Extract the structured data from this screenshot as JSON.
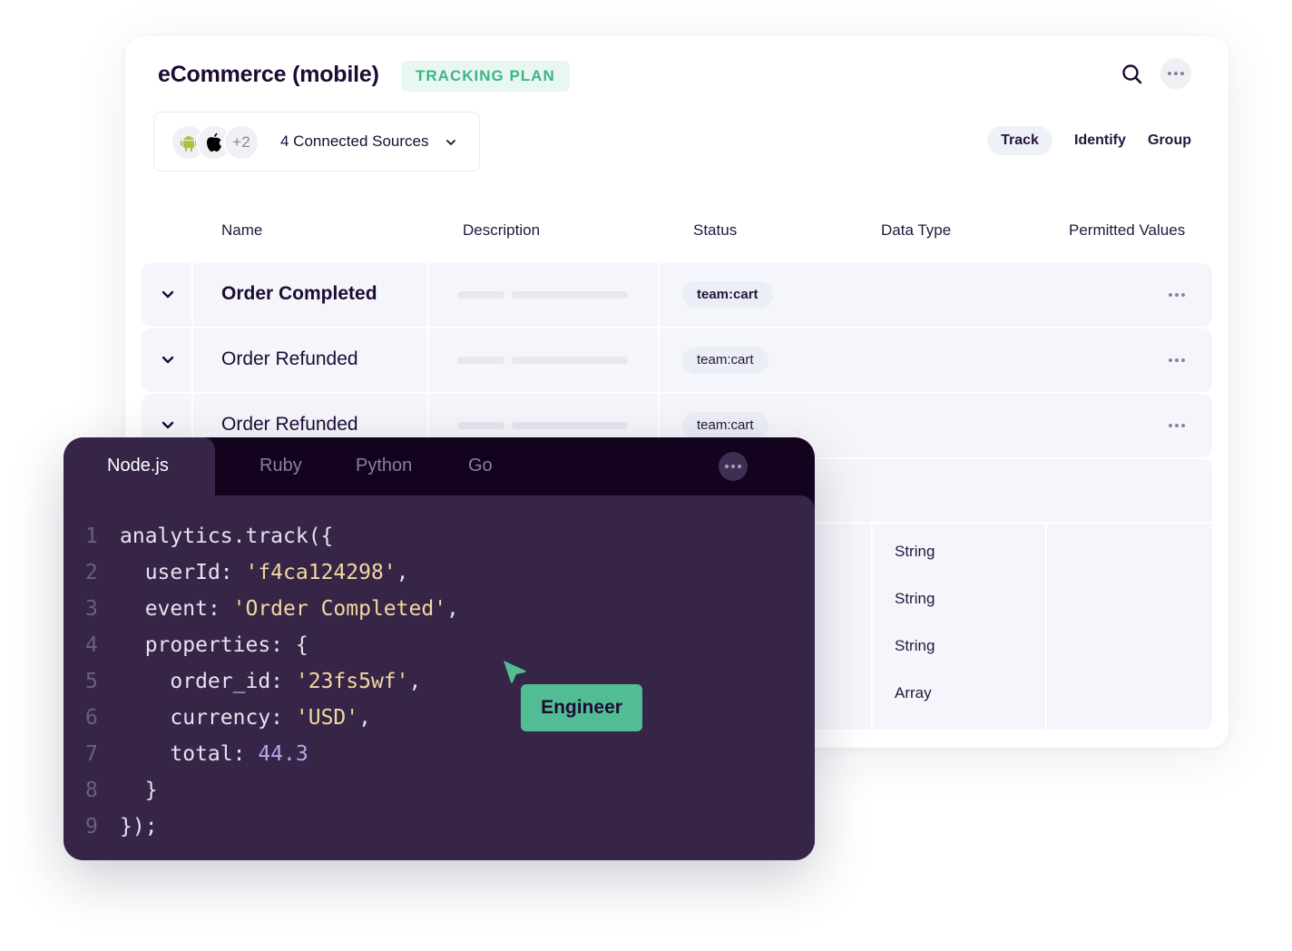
{
  "header": {
    "title": "eCommerce (mobile)",
    "badge": "TRACKING PLAN",
    "search_icon": "search-icon",
    "more_icon": "more-horizontal-icon"
  },
  "sources": {
    "icons": [
      "android-icon",
      "apple-icon"
    ],
    "extra_count": "+2",
    "label": "4 Connected Sources",
    "dropdown_icon": "chevron-down-icon"
  },
  "event_type_tabs": [
    {
      "label": "Track",
      "active": true
    },
    {
      "label": "Identify",
      "active": false
    },
    {
      "label": "Group",
      "active": false
    }
  ],
  "table": {
    "columns": [
      "Name",
      "Description",
      "Status",
      "Data Type",
      "Permitted Values"
    ],
    "rows": [
      {
        "name": "Order Completed",
        "status": "team:cart"
      },
      {
        "name": "Order Refunded",
        "status": "team:cart"
      },
      {
        "name": "Order Refunded",
        "status": "team:cart"
      }
    ],
    "detail_data_types": [
      "String",
      "String",
      "String",
      "Array"
    ]
  },
  "code_panel": {
    "tabs": [
      {
        "label": "Node.js",
        "active": true
      },
      {
        "label": "Ruby",
        "active": false
      },
      {
        "label": "Python",
        "active": false
      },
      {
        "label": "Go",
        "active": false
      }
    ],
    "lines": [
      {
        "n": "1",
        "indent": "",
        "key": "analytics.track({",
        "value": "",
        "value_type": "",
        "suffix": ""
      },
      {
        "n": "2",
        "indent": "  ",
        "key": "userId: ",
        "value": "'f4ca124298'",
        "value_type": "str",
        "suffix": ","
      },
      {
        "n": "3",
        "indent": "  ",
        "key": "event: ",
        "value": "'Order Completed'",
        "value_type": "str",
        "suffix": ","
      },
      {
        "n": "4",
        "indent": "  ",
        "key": "properties: {",
        "value": "",
        "value_type": "",
        "suffix": ""
      },
      {
        "n": "5",
        "indent": "    ",
        "key": "order_id: ",
        "value": "'23fs5wf'",
        "value_type": "str",
        "suffix": ","
      },
      {
        "n": "6",
        "indent": "    ",
        "key": "currency: ",
        "value": "'USD'",
        "value_type": "str",
        "suffix": ","
      },
      {
        "n": "7",
        "indent": "    ",
        "key": "total: ",
        "value": "44.3",
        "value_type": "num",
        "suffix": ""
      },
      {
        "n": "8",
        "indent": "  ",
        "key": "}",
        "value": "",
        "value_type": "",
        "suffix": ""
      },
      {
        "n": "9",
        "indent": "",
        "key": "});",
        "value": "",
        "value_type": "",
        "suffix": ""
      }
    ]
  },
  "collaborator_cursor": {
    "label": "Engineer",
    "color": "#52bd94"
  },
  "colors": {
    "brand_dark": "#1d0b33",
    "accent_green": "#3db488",
    "code_bg": "#362546",
    "code_tabbar_bg": "#14031f",
    "string_color": "#f3d8a2",
    "number_color": "#b8a6ee"
  }
}
